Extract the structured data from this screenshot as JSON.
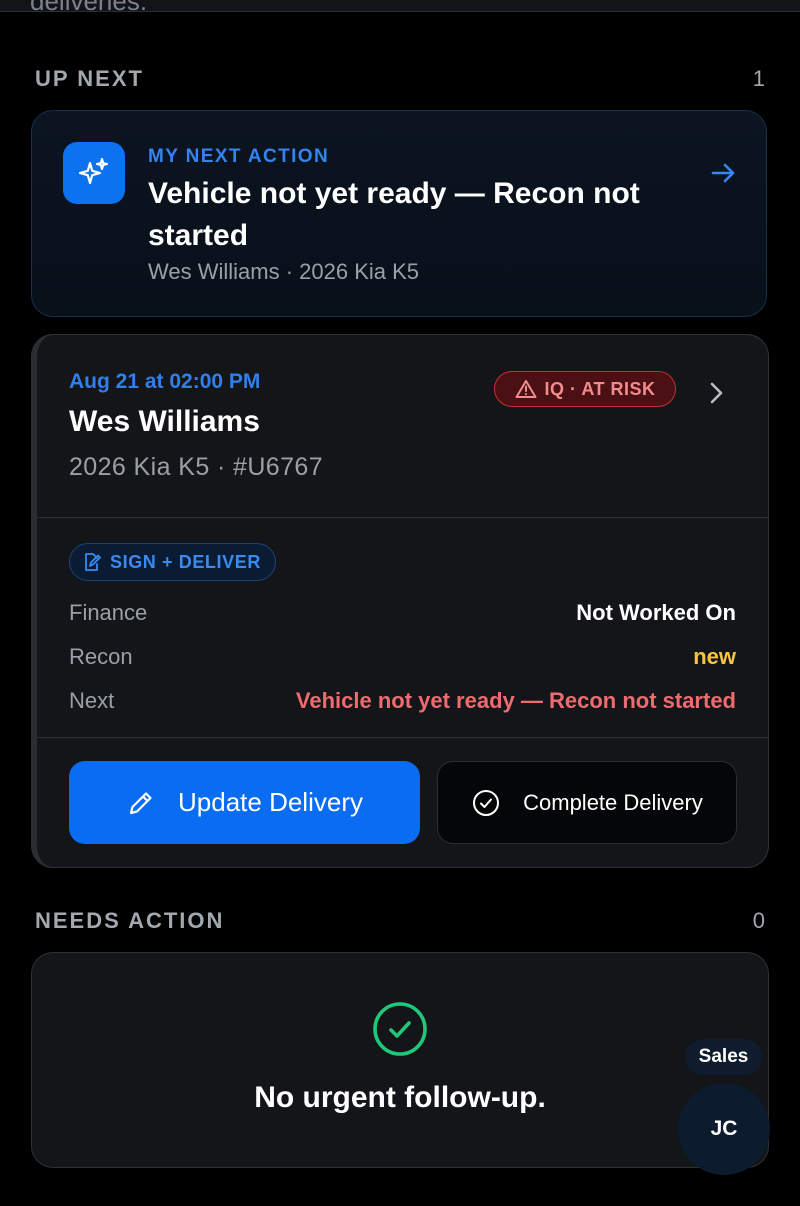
{
  "top_partial_text": "deliveries.",
  "up_next": {
    "title": "UP NEXT",
    "count": "1",
    "next_action": {
      "kicker": "MY NEXT ACTION",
      "title": "Vehicle not yet ready — Recon not started",
      "subtitle": "Wes Williams · 2026 Kia K5",
      "icon": "sparkles-icon",
      "arrow_icon": "arrow-right-icon"
    }
  },
  "delivery": {
    "datetime": "Aug 21 at 02:00 PM",
    "customer": "Wes Williams",
    "vehicle": "2026 Kia K5 · #U6767",
    "risk_badge": "IQ · AT RISK",
    "stage": "SIGN + DELIVER",
    "rows": [
      {
        "label": "Finance",
        "value": "Not Worked On",
        "color": "#ffffff"
      },
      {
        "label": "Recon",
        "value": "new",
        "color": "#f5c542"
      },
      {
        "label": "Next",
        "value": "Vehicle not yet ready — Recon not started",
        "color": "#f06b6f"
      }
    ],
    "update_button": "Update Delivery",
    "complete_button": "Complete Delivery"
  },
  "needs_action": {
    "title": "NEEDS ACTION",
    "count": "0",
    "empty_message": "No urgent follow-up."
  },
  "user": {
    "role": "Sales",
    "initials": "JC"
  },
  "colors": {
    "accent": "#0a6cf2",
    "risk": "#c42f35",
    "success": "#1fc77a"
  }
}
